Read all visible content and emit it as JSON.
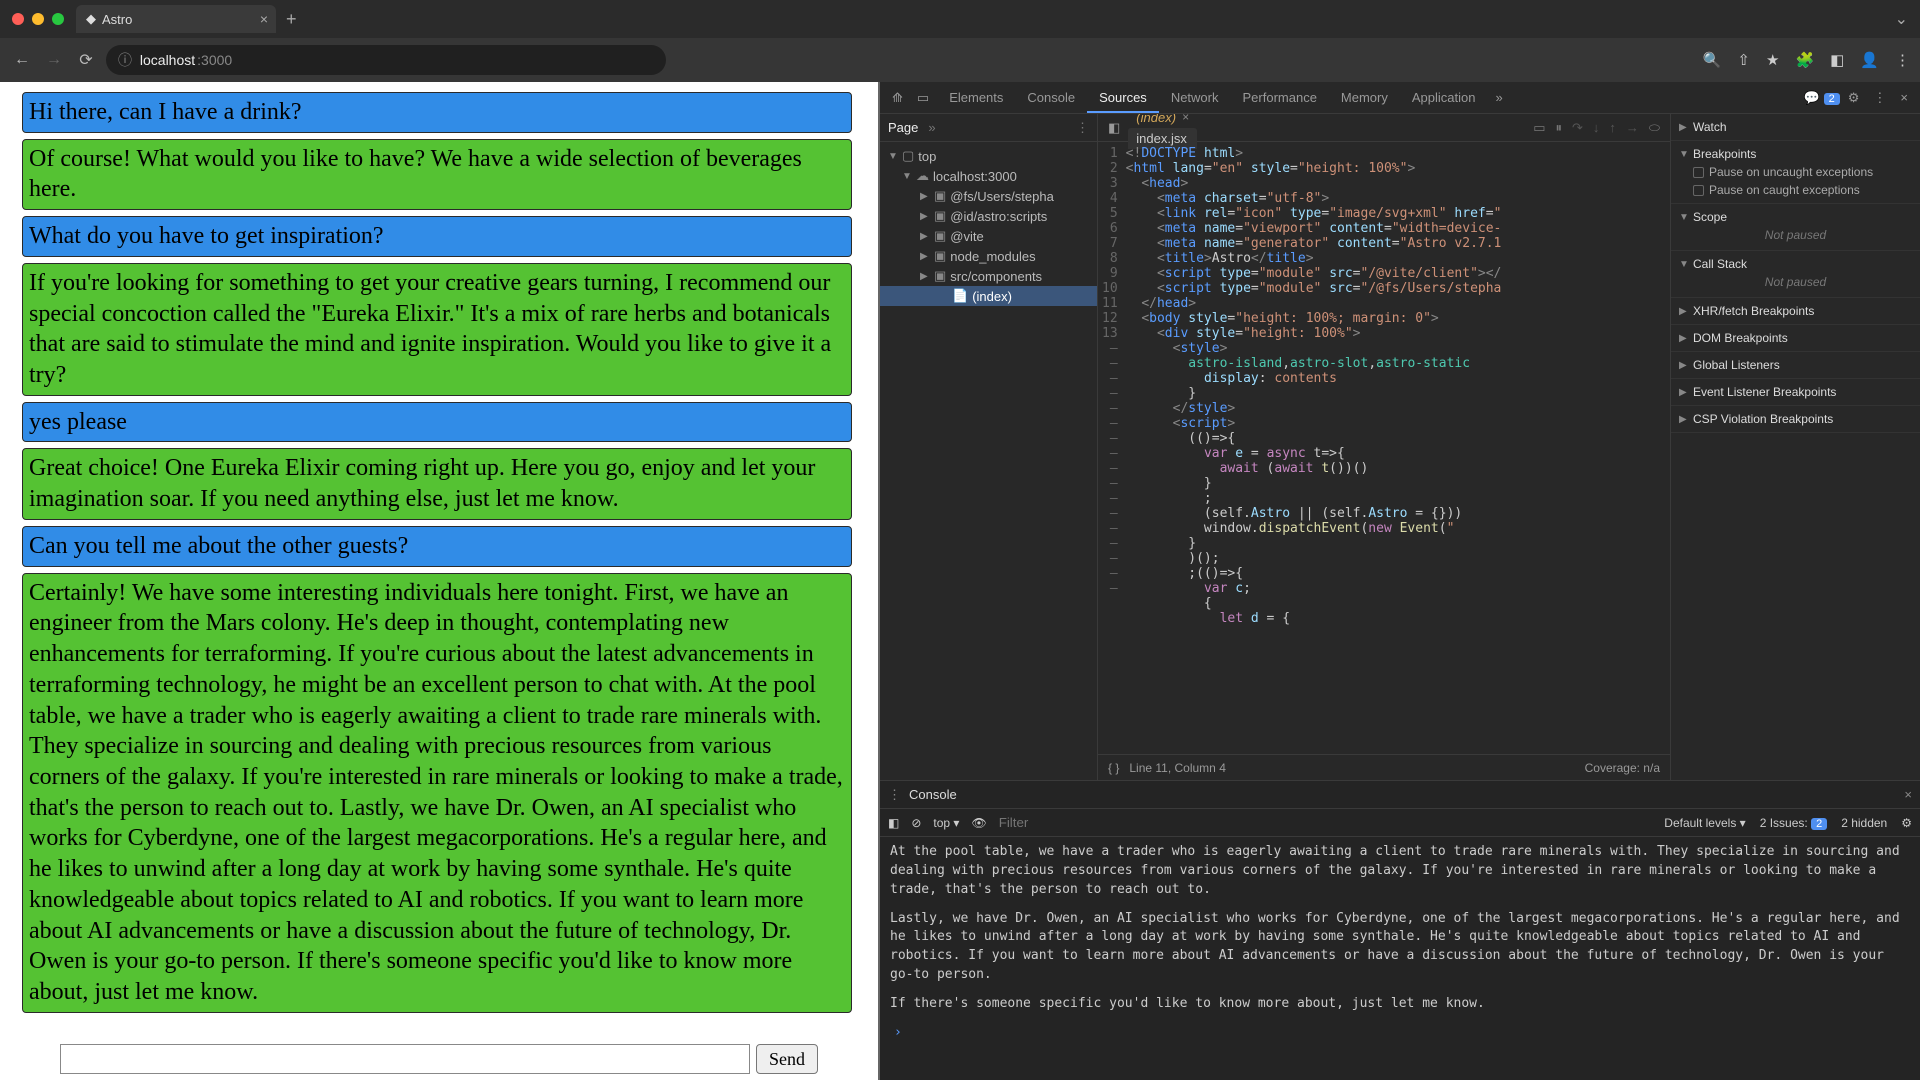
{
  "window": {
    "tab_title": "Astro",
    "url_host": "localhost",
    "url_port": ":3000"
  },
  "chat": {
    "messages": [
      {
        "role": "user",
        "text": "Hi there, can I have a drink?"
      },
      {
        "role": "bot",
        "text": "Of course! What would you like to have? We have a wide selection of beverages here."
      },
      {
        "role": "user",
        "text": "What do you have to get inspiration?"
      },
      {
        "role": "bot",
        "text": "If you're looking for something to get your creative gears turning, I recommend our special concoction called the \"Eureka Elixir.\" It's a mix of rare herbs and botanicals that are said to stimulate the mind and ignite inspiration. Would you like to give it a try?"
      },
      {
        "role": "user",
        "text": "yes please"
      },
      {
        "role": "bot",
        "text": "Great choice! One Eureka Elixir coming right up. Here you go, enjoy and let your imagination soar. If you need anything else, just let me know."
      },
      {
        "role": "user",
        "text": "Can you tell me about the other guests?"
      },
      {
        "role": "bot",
        "text": "Certainly! We have some interesting individuals here tonight. First, we have an engineer from the Mars colony. He's deep in thought, contemplating new enhancements for terraforming. If you're curious about the latest advancements in terraforming technology, he might be an excellent person to chat with. At the pool table, we have a trader who is eagerly awaiting a client to trade rare minerals with. They specialize in sourcing and dealing with precious resources from various corners of the galaxy. If you're interested in rare minerals or looking to make a trade, that's the person to reach out to. Lastly, we have Dr. Owen, an AI specialist who works for Cyberdyne, one of the largest megacorporations. He's a regular here, and he likes to unwind after a long day at work by having some synthale. He's quite knowledgeable about topics related to AI and robotics. If you want to learn more about AI advancements or have a discussion about the future of technology, Dr. Owen is your go-to person. If there's someone specific you'd like to know more about, just let me know."
      }
    ],
    "send_label": "Send",
    "input_placeholder": ""
  },
  "devtools": {
    "tabs": [
      "Elements",
      "Console",
      "Sources",
      "Network",
      "Performance",
      "Memory",
      "Application"
    ],
    "active_tab": "Sources",
    "issues_count": "2",
    "file_panel": {
      "page_label": "Page",
      "top": "top",
      "host": "localhost:3000",
      "folders": [
        "@fs/Users/stepha",
        "@id/astro:scripts",
        "@vite",
        "node_modules",
        "src/components"
      ],
      "file": "(index)"
    },
    "editor": {
      "tabs": [
        {
          "name": "(index)",
          "active": true
        },
        {
          "name": "index.jsx",
          "active": false
        }
      ],
      "status_left": "Line 11, Column 4",
      "status_right": "Coverage: n/a"
    },
    "debug": {
      "watch": "Watch",
      "breakpoints": "Breakpoints",
      "bp1": "Pause on uncaught exceptions",
      "bp2": "Pause on caught exceptions",
      "scope": "Scope",
      "not_paused": "Not paused",
      "callstack": "Call Stack",
      "xhr": "XHR/fetch Breakpoints",
      "dom": "DOM Breakpoints",
      "global": "Global Listeners",
      "event": "Event Listener Breakpoints",
      "csp": "CSP Violation Breakpoints"
    },
    "console": {
      "title": "Console",
      "context": "top",
      "filter_placeholder": "Filter",
      "levels": "Default levels",
      "issues_label": "2 Issues:",
      "issues_badge": "2",
      "hidden": "2 hidden",
      "lines": [
        "At the pool table, we have a trader who is eagerly awaiting a client to trade rare minerals with. They specialize in sourcing and dealing with precious resources from various corners of the galaxy. If you're interested in rare minerals or looking to make a trade, that's the person to reach out to.",
        "Lastly, we have Dr. Owen, an AI specialist who works for Cyberdyne, one of the largest megacorporations. He's a regular here, and he likes to unwind after a long day at work by having some synthale. He's quite knowledgeable about topics related to AI and robotics. If you want to learn more about AI advancements or have a discussion about the future of technology, Dr. Owen is your go-to person.",
        "If there's someone specific you'd like to know more about, just let me know."
      ]
    }
  }
}
